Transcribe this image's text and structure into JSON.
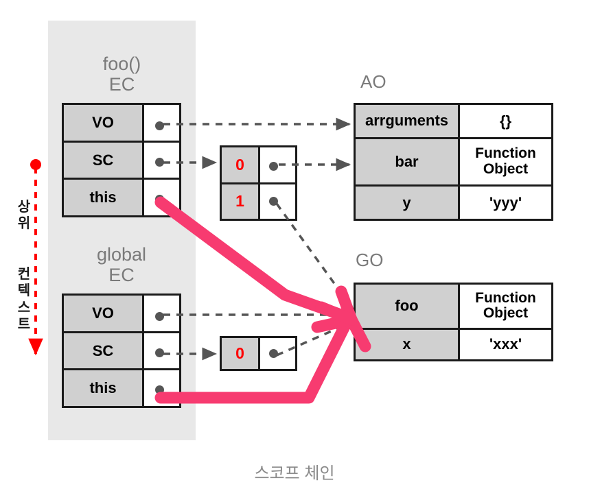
{
  "diagram": {
    "caption": "스코프 체인",
    "upper_context_label_1": "상위",
    "upper_context_label_2": "컨텍스트",
    "colors": {
      "panel_bg": "#e8e8e8",
      "key_cell_bg": "#d0d0d0",
      "border": "#1a1a1a",
      "title_gray": "#7a7a7a",
      "pink_arrow": "#f73b70",
      "red_arrow": "#ff0000",
      "dashed_arrow": "#555555",
      "red_text": "#ff0000"
    }
  },
  "contexts": [
    {
      "title_line1": "foo()",
      "title_line2": "EC",
      "rows": [
        {
          "key": "VO",
          "value": ""
        },
        {
          "key": "SC",
          "value": ""
        },
        {
          "key": "this",
          "value": ""
        }
      ]
    },
    {
      "title_line1": "global",
      "title_line2": "EC",
      "rows": [
        {
          "key": "VO",
          "value": ""
        },
        {
          "key": "SC",
          "value": ""
        },
        {
          "key": "this",
          "value": ""
        }
      ]
    }
  ],
  "scope_chains": [
    {
      "name": "foo-scope-chain",
      "rows": [
        {
          "index": "0",
          "value": ""
        },
        {
          "index": "1",
          "value": ""
        }
      ]
    },
    {
      "name": "global-scope-chain",
      "rows": [
        {
          "index": "0",
          "value": ""
        }
      ]
    }
  ],
  "objects": [
    {
      "title": "AO",
      "rows": [
        {
          "key": "arrguments",
          "value": "{}"
        },
        {
          "key": "bar",
          "value": "Function\nObject"
        },
        {
          "key": "y",
          "value": "'yyy'"
        }
      ]
    },
    {
      "title": "GO",
      "rows": [
        {
          "key": "foo",
          "value": "Function\nObject"
        },
        {
          "key": "x",
          "value": "'xxx'"
        }
      ]
    }
  ]
}
